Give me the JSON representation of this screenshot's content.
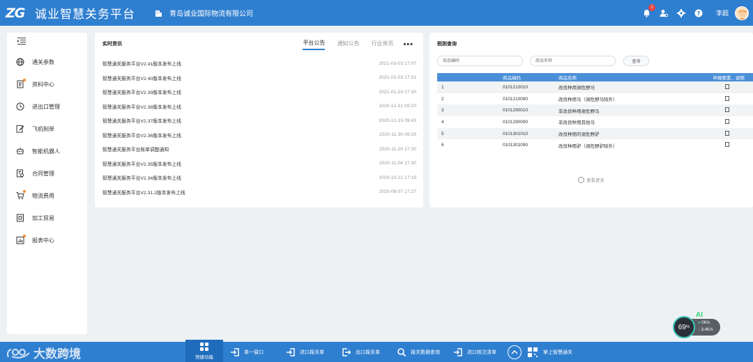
{
  "app": {
    "logo_mark": "ZG",
    "title": "诚业智慧关务平台",
    "company": "青岛诚业国际物流有限公司",
    "notification_count": "2",
    "username": "李超"
  },
  "sidebar": {
    "items": [
      {
        "label": "通关参数",
        "icon": "globe-icon",
        "dot": false
      },
      {
        "label": "资料中心",
        "icon": "document-icon",
        "dot": true
      },
      {
        "label": "进出口管理",
        "icon": "clock-icon",
        "dot": false
      },
      {
        "label": "飞机制单",
        "icon": "edit-icon",
        "dot": false
      },
      {
        "label": "智能机器人",
        "icon": "robot-icon",
        "dot": false
      },
      {
        "label": "合同管理",
        "icon": "contract-icon",
        "dot": false
      },
      {
        "label": "物流费用",
        "icon": "cart-icon",
        "dot": true
      },
      {
        "label": "加工贸易",
        "icon": "box-icon",
        "dot": false
      },
      {
        "label": "报表中心",
        "icon": "report-icon",
        "dot": true
      }
    ]
  },
  "news": {
    "title": "实时资讯",
    "tabs": [
      "平台公告",
      "通知公告",
      "行业资讯"
    ],
    "active_tab": "平台公告",
    "more": "•••",
    "items": [
      {
        "title": "智慧通关服务平台V2.41版本发布上线",
        "date": "2021-03-03 17:07"
      },
      {
        "title": "智慧通关服务平台V2.40版本发布上线",
        "date": "2021-02-03 17:31"
      },
      {
        "title": "智慧通关服务平台V2.39版本发布上线",
        "date": "2021-01-18 17:30"
      },
      {
        "title": "智慧通关服务平台V2.38版本发布上线",
        "date": "2020-12-31 09:20"
      },
      {
        "title": "智慧通关服务平台V2.37版本发布上线",
        "date": "2020-12-15 09:43"
      },
      {
        "title": "智慧通关服务平台V2.36版本发布上线",
        "date": "2020-11-30 09:29"
      },
      {
        "title": "智慧通关服务平台账单调整通知",
        "date": "2020-11-20 17:30"
      },
      {
        "title": "智慧通关服务平台V2.35版本发布上线",
        "date": "2020-11-04 17:30"
      },
      {
        "title": "智慧通关服务平台V2.34版本发布上线",
        "date": "2020-10-21 17:19"
      },
      {
        "title": "智慧通关服务平台V2.31.2版本发布上线",
        "date": "2020-08-07 17:27"
      }
    ]
  },
  "tariff": {
    "title": "税则查询",
    "code_placeholder": "商品编码",
    "name_placeholder": "商品名称",
    "search_label": "查询",
    "columns": [
      "",
      "商品编码",
      "商品名称",
      "申报要素、退税"
    ],
    "rows": [
      {
        "idx": "1",
        "code": "0101210010",
        "name": "改良种用濒危野马"
      },
      {
        "idx": "2",
        "code": "0101210090",
        "name": "改良种用马（濒危野马除外）"
      },
      {
        "idx": "3",
        "code": "0101290010",
        "name": "非改良种用濒危野马"
      },
      {
        "idx": "4",
        "code": "0101290090",
        "name": "非改良种用其他马"
      },
      {
        "idx": "5",
        "code": "0101301010",
        "name": "改良种用的濒危野驴"
      },
      {
        "idx": "6",
        "code": "0101301090",
        "name": "改良种用驴（濒危野驴除外）"
      }
    ],
    "see_more": "查看更多"
  },
  "bottom_bar": {
    "brand": "大数跨境",
    "quick_label": "快捷功能",
    "items": [
      "单一窗口",
      "进口报关单",
      "出口报关单",
      "报关数据查询",
      "进口核注清单",
      "掌上智慧通关"
    ]
  },
  "net_widget": {
    "percent": "69",
    "percent_unit": "%",
    "ai_label": "AI",
    "up_rate": "0K/s",
    "down_rate": "3.4K/s"
  },
  "colors": {
    "primary": "#2f7fd0",
    "table_header": "#4a8fd8",
    "badge": "#e84141",
    "dot": "#f28b2c"
  }
}
